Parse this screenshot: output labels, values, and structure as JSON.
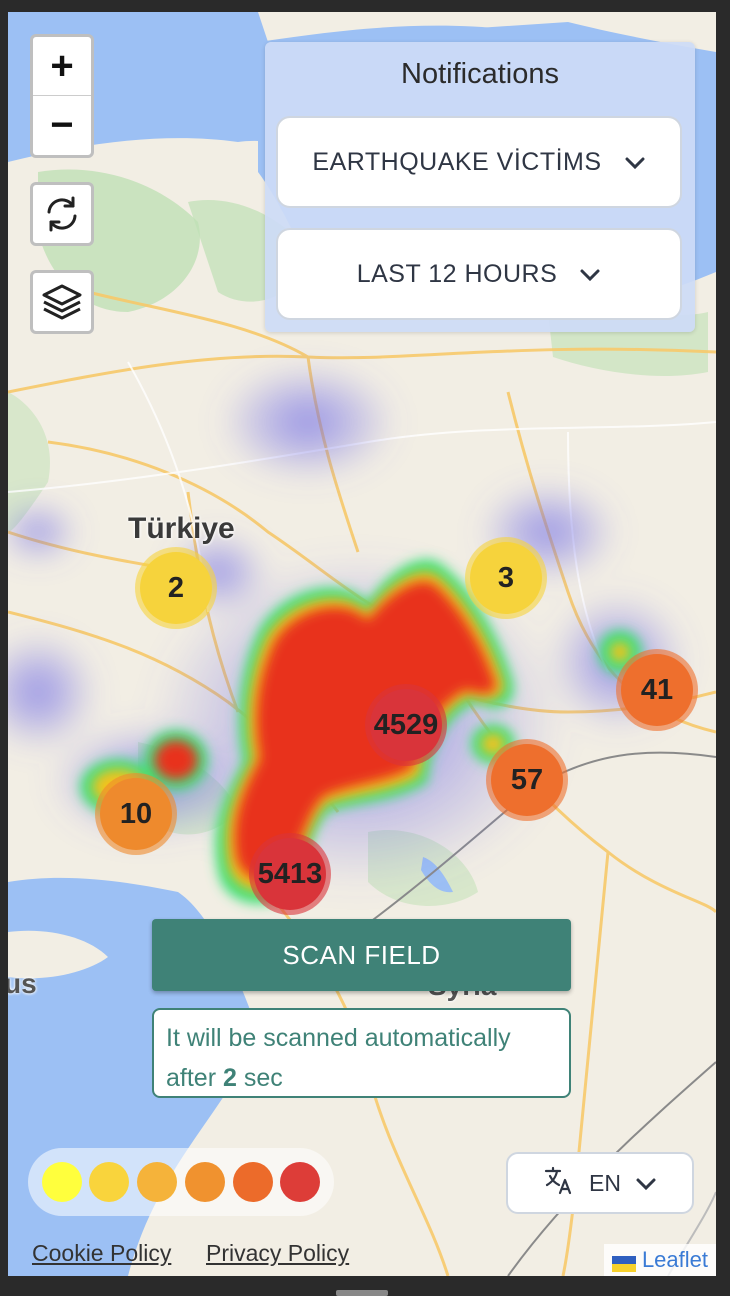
{
  "map": {
    "country_label": "Türkiye",
    "partial_labels": {
      "left": "us",
      "bottom": "Syria"
    },
    "clusters": [
      {
        "count": "2",
        "color": "#f6d33c"
      },
      {
        "count": "3",
        "color": "#f6d33c"
      },
      {
        "count": "4529",
        "color": "#d9343a"
      },
      {
        "count": "41",
        "color": "#ee6f2d"
      },
      {
        "count": "57",
        "color": "#ee6f2d"
      },
      {
        "count": "10",
        "color": "#ee8a2d"
      },
      {
        "count": "5413",
        "color": "#d9343a"
      }
    ]
  },
  "controls": {
    "zoom_in": "+",
    "zoom_out": "−"
  },
  "notifications": {
    "title": "Notifications",
    "category": "EARTHQUAKE VİCTİMS",
    "time_range": "LAST 12 HOURS"
  },
  "scan": {
    "button_label": "SCAN FIELD",
    "note_prefix": "It will be scanned automatically after",
    "note_seconds": "2",
    "note_suffix": "sec"
  },
  "legend": {
    "colors": [
      "#ffff3d",
      "#f9d43c",
      "#f5b33a",
      "#f0922f",
      "#ec6b2a",
      "#dd3d38"
    ]
  },
  "language": {
    "selected": "EN"
  },
  "footer": {
    "cookie_policy": "Cookie Policy",
    "privacy_policy": "Privacy Policy",
    "attribution": "Leaflet"
  }
}
